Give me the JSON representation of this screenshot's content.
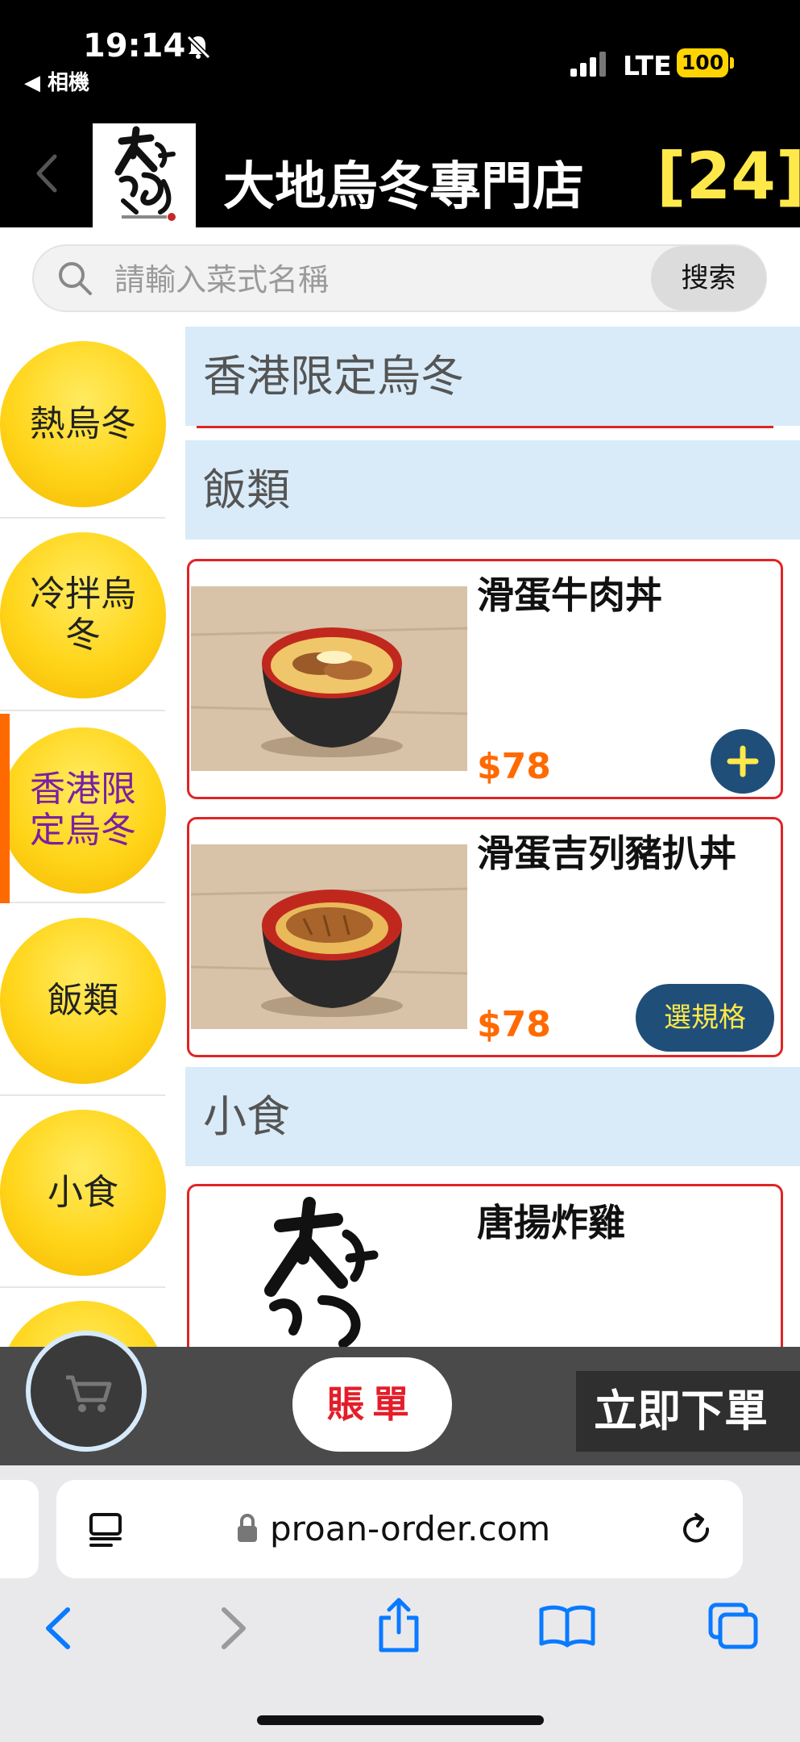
{
  "status_bar": {
    "time": "19:14",
    "back_app": "◀ 相機",
    "network": "LTE",
    "battery": "100"
  },
  "header": {
    "store_name": "大地烏冬專門店",
    "table_number": "[24]",
    "logo_alt": "大地うどん 烏冬專門店"
  },
  "search": {
    "placeholder": "請輸入菜式名稱",
    "button": "搜索"
  },
  "categories": [
    {
      "label": "熱烏冬",
      "active": false
    },
    {
      "label": "冷拌烏冬",
      "active": false
    },
    {
      "label": "香港限定烏冬",
      "active": true
    },
    {
      "label": "飯類",
      "active": false
    },
    {
      "label": "小食",
      "active": false
    }
  ],
  "sections": [
    {
      "title": "香港限定烏冬"
    },
    {
      "title": "飯類"
    },
    {
      "title": "小食"
    }
  ],
  "items": [
    {
      "name": "滑蛋牛肉丼",
      "price": "$78",
      "action": "+"
    },
    {
      "name": "滑蛋吉列豬扒丼",
      "price": "$78",
      "action": "選規格"
    },
    {
      "name": "唐揚炸雞"
    }
  ],
  "order_bar": {
    "bill": "賬單",
    "order_now": "立即下單"
  },
  "browser": {
    "url": "proan-order.com"
  },
  "colors": {
    "accent_orange": "#FF6A00",
    "button_navy": "#1F4E79",
    "highlight_yellow": "#FFE94A",
    "card_border": "#E02424",
    "section_bg": "#D9EBF8"
  }
}
